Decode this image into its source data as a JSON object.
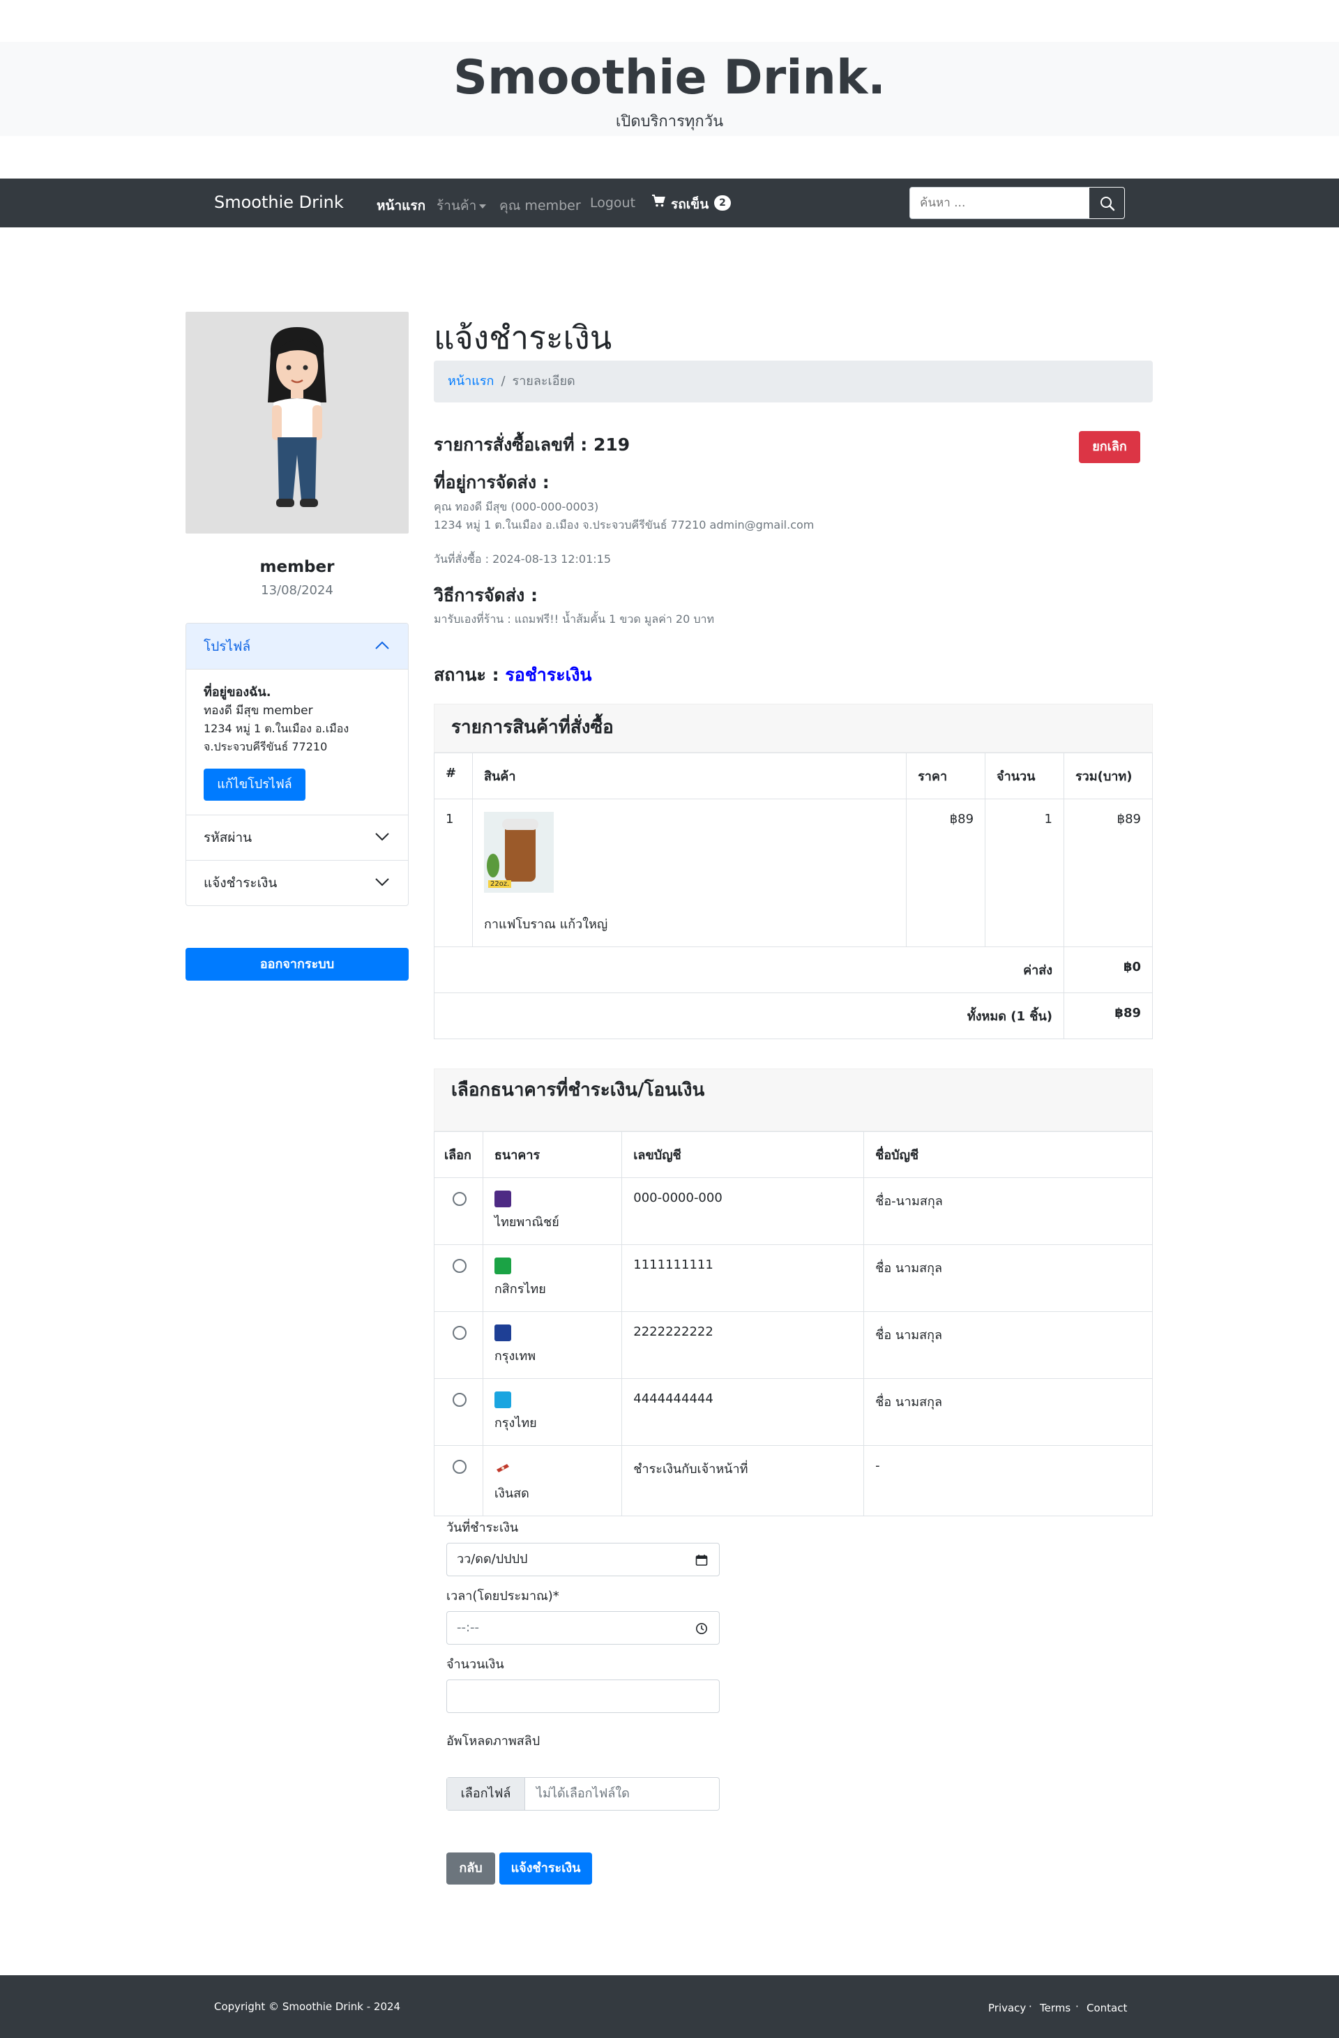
{
  "header": {
    "title": "Smoothie Drink.",
    "subtitle": "เปิดบริการทุกวัน"
  },
  "navbar": {
    "brand": "Smoothie Drink",
    "home": "หน้าแรก",
    "shop": "ร้านค้า",
    "user": "คุณ member",
    "logout": "Logout",
    "cart_label": "รถเข็น",
    "cart_count": "2",
    "search_placeholder": "ค้นหา ..."
  },
  "sidebar": {
    "username": "member",
    "date": "13/08/2024",
    "profile_heading": "โปรไฟล์",
    "address_heading": "ที่อยู่ของฉัน.",
    "address_name": "ทองดี มีสุข member",
    "address_line1": "1234 หมู่ 1 ต.ในเมือง อ.เมือง",
    "address_line2": "จ.ประจวบคีรีขันธ์ 77210",
    "edit_profile": "แก้ไขโปรไฟล์",
    "password_heading": "รหัสผ่าน",
    "payment_heading": "แจ้งชำระเงิน",
    "logout_button": "ออกจากระบบ"
  },
  "main": {
    "title": "แจ้งชำระเงิน",
    "breadcrumb_home": "หน้าแรก",
    "breadcrumb_sep": "/",
    "breadcrumb_current": "รายละเอียด",
    "order_number": "รายการสั่งซื้อเลขที่ : 219",
    "cancel_button": "ยกเลิก",
    "shipping_address_heading": "ที่อยู่การจัดส่ง :",
    "shipping_line1": "คุณ ทองดี มีสุข (000-000-0003)",
    "shipping_line2": "1234 หมู่ 1 ต.ในเมือง อ.เมือง จ.ประจวบคีรีขันธ์ 77210 admin@gmail.com",
    "order_date": "วันที่สั่งซื้อ : 2024-08-13 12:01:15",
    "shipping_method_heading": "วิธีการจัดส่ง :",
    "shipping_method": "มารับเองที่ร้าน : แถมฟรี!! น้ำส้มคั้น 1 ขวด มูลค่า 20 บาท",
    "status_label": "สถานะ :",
    "status_value": "รอชำระเงิน"
  },
  "items": {
    "heading": "รายการสินค้าที่สั่งซื้อ",
    "columns": [
      "#",
      "สินค้า",
      "ราคา",
      "จำนวน",
      "รวม(บาท)"
    ],
    "rows": [
      {
        "no": "1",
        "name": "กาแฟโบราณ แก้วใหญ่",
        "price": "฿89",
        "qty": "1",
        "total": "฿89",
        "image_tag": "22oz."
      }
    ],
    "shipping_label": "ค่าส่ง",
    "shipping_value": "฿0",
    "total_label": "ทั้งหมด (1 ชิ้น)",
    "total_value": "฿89"
  },
  "banks": {
    "heading": "เลือกธนาคารที่ชำระเงิน/โอนเงิน",
    "columns": [
      "เลือก",
      "ธนาคาร",
      "เลขบัญชี",
      "ชื่อบัญชี"
    ],
    "rows": [
      {
        "bank": "ไทยพาณิชย์",
        "account": "000-0000-000",
        "name": "ชื่อ-นามสกุล",
        "color": "#4e2a84",
        "icon": "scb-logo"
      },
      {
        "bank": "กสิกรไทย",
        "account": "1111111111",
        "name": "ชื่อ นามสกุล",
        "color": "#1ba345",
        "icon": "kbank-logo"
      },
      {
        "bank": "กรุงเทพ",
        "account": "2222222222",
        "name": "ชื่อ นามสกุล",
        "color": "#1e3f95",
        "icon": "bbl-logo"
      },
      {
        "bank": "กรุงไทย",
        "account": "4444444444",
        "name": "ชื่อ นามสกุล",
        "color": "#1ba5e0",
        "icon": "ktb-logo"
      },
      {
        "bank": "เงินสด",
        "account": "ชำระเงินกับเจ้าหน้าที่",
        "name": "-",
        "color": "#c0392b",
        "icon": "cash-logo"
      }
    ]
  },
  "form": {
    "date_label": "วันที่ชำระเงิน",
    "date_placeholder": "วว/ดด/ปปปป",
    "time_label": "เวลา(โดยประมาณ)*",
    "time_placeholder": "--:--",
    "amount_label": "จำนวนเงิน",
    "amount_value": "",
    "upload_label": "อัพโหลดภาพสลิป",
    "file_button": "เลือกไฟล์",
    "file_none": "ไม่ได้เลือกไฟล์ใด",
    "back_button": "กลับ",
    "submit_button": "แจ้งชำระเงิน"
  },
  "footer": {
    "copyright": "Copyright © Smoothie Drink - 2024",
    "privacy": "Privacy",
    "terms": "Terms",
    "contact": "Contact",
    "dot": "·"
  }
}
